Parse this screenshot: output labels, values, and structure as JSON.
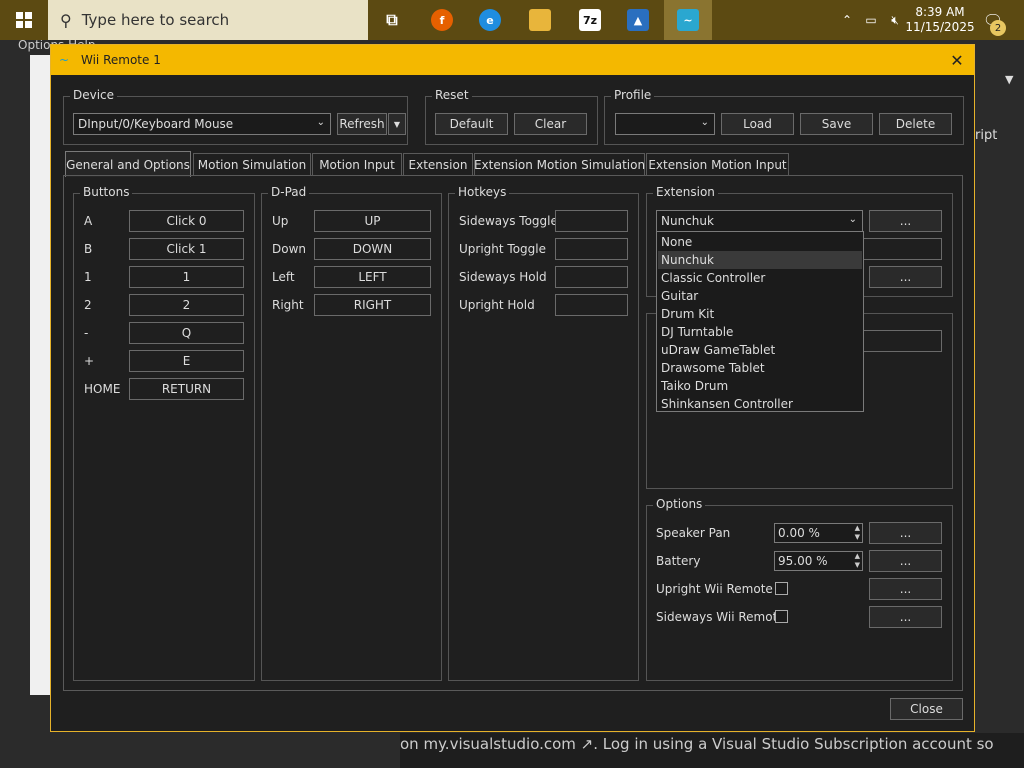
{
  "taskbar": {
    "search_placeholder": "Type here to search",
    "time": "8:39 AM",
    "date": "11/15/2025",
    "notification_count": "2",
    "apps": [
      {
        "name": "task-view-icon",
        "glyph": "⧉",
        "color": "#5c4a12"
      },
      {
        "name": "firefox-icon",
        "glyph": "●",
        "color": "#e66000"
      },
      {
        "name": "edge-icon",
        "glyph": "◐",
        "color": "#1f8de0"
      },
      {
        "name": "file-explorer-icon",
        "glyph": "▬",
        "color": "#e8b53b"
      },
      {
        "name": "7zip-icon",
        "glyph": "7z",
        "color": "#111111"
      },
      {
        "name": "app-icon",
        "glyph": "▲",
        "color": "#2a6fbf"
      },
      {
        "name": "dolphin-icon",
        "glyph": "~",
        "color": "#2aa7d0"
      }
    ]
  },
  "background": {
    "menubar": "Options   Help",
    "bottom_text": "on my.visualstudio.com ↗. Log in using a Visual Studio Subscription account so",
    "right_label": "ript"
  },
  "window": {
    "title": "Wii Remote 1",
    "device": {
      "label": "Device",
      "value": "DInput/0/Keyboard Mouse",
      "refresh": "Refresh"
    },
    "reset": {
      "label": "Reset",
      "default": "Default",
      "clear": "Clear"
    },
    "profile": {
      "label": "Profile",
      "value": "",
      "load": "Load",
      "save": "Save",
      "delete": "Delete"
    },
    "tabs": [
      "General and Options",
      "Motion Simulation",
      "Motion Input",
      "Extension",
      "Extension Motion Simulation",
      "Extension Motion Input"
    ],
    "buttons": {
      "label": "Buttons",
      "rows": [
        {
          "name": "A",
          "value": "Click 0"
        },
        {
          "name": "B",
          "value": "Click 1"
        },
        {
          "name": "1",
          "value": "1"
        },
        {
          "name": "2",
          "value": "2"
        },
        {
          "name": "-",
          "value": "Q"
        },
        {
          "name": "+",
          "value": "E"
        },
        {
          "name": "HOME",
          "value": "RETURN"
        }
      ]
    },
    "dpad": {
      "label": "D-Pad",
      "rows": [
        {
          "name": "Up",
          "value": "UP"
        },
        {
          "name": "Down",
          "value": "DOWN"
        },
        {
          "name": "Left",
          "value": "LEFT"
        },
        {
          "name": "Right",
          "value": "RIGHT"
        }
      ]
    },
    "hotkeys": {
      "label": "Hotkeys",
      "rows": [
        {
          "name": "Sideways Toggle",
          "value": ""
        },
        {
          "name": "Upright Toggle",
          "value": ""
        },
        {
          "name": "Sideways Hold",
          "value": ""
        },
        {
          "name": "Upright Hold",
          "value": ""
        }
      ]
    },
    "extension": {
      "label": "Extension",
      "selected": "Nunchuk",
      "more": "...",
      "options": [
        "None",
        "Nunchuk",
        "Classic Controller",
        "Guitar",
        "Drum Kit",
        "DJ Turntable",
        "uDraw GameTablet",
        "Drawsome Tablet",
        "Taiko Drum",
        "Shinkansen Controller"
      ]
    },
    "options": {
      "label": "Options",
      "speaker_pan_label": "Speaker Pan",
      "speaker_pan_value": "0.00 %",
      "battery_label": "Battery",
      "battery_value": "95.00 %",
      "upright_label": "Upright Wii Remote",
      "sideways_label": "Sideways Wii Remote",
      "more": "..."
    },
    "close": "Close"
  }
}
